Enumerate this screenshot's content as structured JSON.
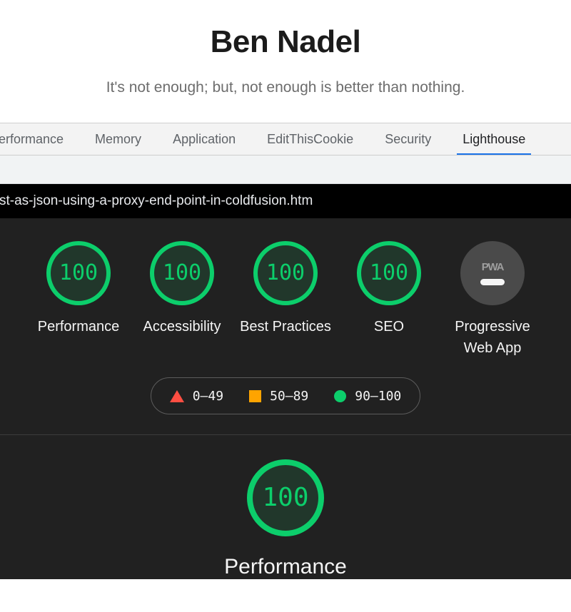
{
  "site": {
    "title": "Ben Nadel",
    "tagline": "It's not enough; but, not enough is better than nothing."
  },
  "devtools": {
    "tabs": [
      {
        "label": "erformance",
        "active": false
      },
      {
        "label": "Memory",
        "active": false
      },
      {
        "label": "Application",
        "active": false
      },
      {
        "label": "EditThisCookie",
        "active": false
      },
      {
        "label": "Security",
        "active": false
      },
      {
        "label": "Lighthouse",
        "active": true
      }
    ],
    "active_tab": "Lighthouse",
    "accent_color": "#1a73e8"
  },
  "lighthouse": {
    "url": "st-as-json-using-a-proxy-end-point-in-coldfusion.htm",
    "scores": [
      {
        "label": "Performance",
        "value": "100",
        "state": "pass"
      },
      {
        "label": "Accessibility",
        "value": "100",
        "state": "pass"
      },
      {
        "label": "Best Practices",
        "value": "100",
        "state": "pass"
      },
      {
        "label": "SEO",
        "value": "100",
        "state": "pass"
      },
      {
        "label": "Progressive Web App",
        "value": "",
        "state": "pwa",
        "wordmark": "PWA"
      }
    ],
    "legend": [
      {
        "shape": "triangle",
        "range": "0–49",
        "color": "#ff4e42"
      },
      {
        "shape": "square",
        "range": "50–89",
        "color": "#ffa400"
      },
      {
        "shape": "circle",
        "range": "90–100",
        "color": "#0cce6b"
      }
    ],
    "category_detail": {
      "title": "Performance",
      "score": "100"
    },
    "colors": {
      "pass": "#0cce6b",
      "average": "#ffa400",
      "fail": "#ff4e42",
      "background": "#212121",
      "urlbar_background": "#000000"
    }
  }
}
